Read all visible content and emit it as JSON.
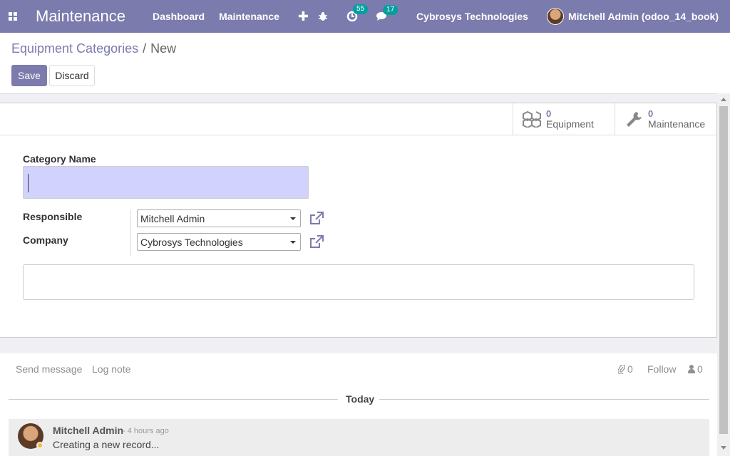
{
  "navbar": {
    "app_title": "Maintenance",
    "menu": [
      "Dashboard",
      "Maintenance"
    ],
    "plus_glyph": "✚",
    "activity_count": "55",
    "messages_count": "17",
    "company": "Cybrosys Technologies",
    "user": "Mitchell Admin (odoo_14_book)",
    "color": "#7c7bad"
  },
  "breadcrumb": {
    "parent": "Equipment Categories",
    "separator": "/",
    "current": "New"
  },
  "buttons": {
    "save": "Save",
    "discard": "Discard"
  },
  "smart_buttons": [
    {
      "value": "0",
      "label": "Equipment",
      "icon": "cubes-icon"
    },
    {
      "value": "0",
      "label": "Maintenance",
      "icon": "wrench-icon"
    }
  ],
  "form": {
    "category_name_label": "Category Name",
    "category_name_value": "",
    "responsible_label": "Responsible",
    "responsible_value": "Mitchell Admin",
    "company_label": "Company",
    "company_value": "Cybrosys Technologies",
    "note_value": ""
  },
  "chatter": {
    "send_message": "Send message",
    "log_note": "Log note",
    "attachments_count": "0",
    "follow": "Follow",
    "followers_count": "0",
    "date_separator": "Today",
    "message": {
      "author": "Mitchell Admin",
      "time": "- 4 hours ago",
      "body": "Creating a new record..."
    }
  }
}
